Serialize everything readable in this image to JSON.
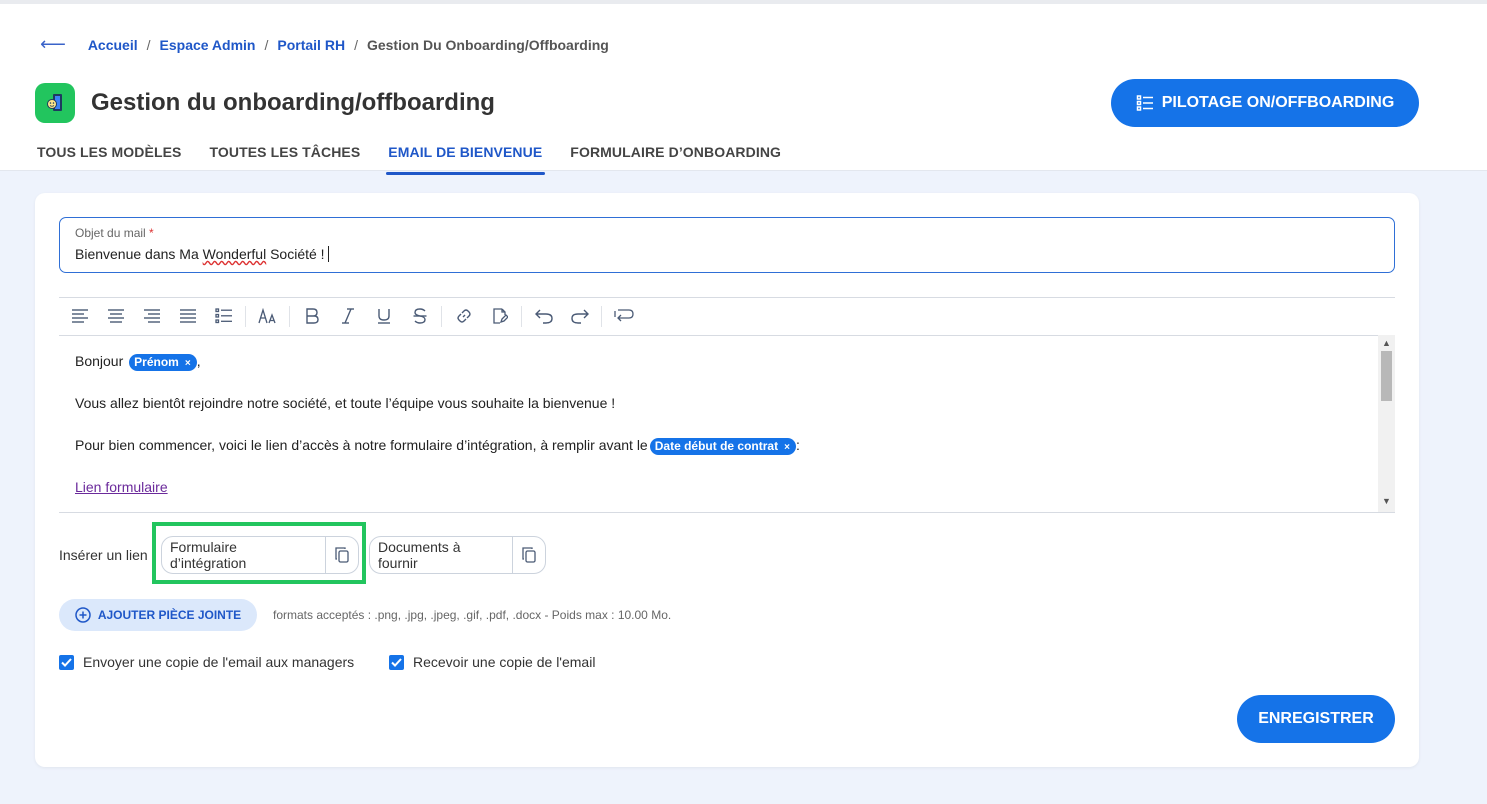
{
  "breadcrumb": {
    "back_icon": "arrow-left-icon",
    "items": [
      "Accueil",
      "Espace Admin",
      "Portail RH"
    ],
    "separator": "/",
    "current": "Gestion Du Onboarding/Offboarding"
  },
  "header": {
    "app_icon": "door-person-icon",
    "title": "Gestion du onboarding/offboarding",
    "pilot_button": "PILOTAGE ON/OFFBOARDING",
    "pilot_icon": "list-icon"
  },
  "tabs": [
    {
      "label": "TOUS LES MODÈLES",
      "active": false
    },
    {
      "label": "TOUTES LES TÂCHES",
      "active": false
    },
    {
      "label": "EMAIL DE BIENVENUE",
      "active": true
    },
    {
      "label": "FORMULAIRE D’ONBOARDING",
      "active": false
    }
  ],
  "subject": {
    "label": "Objet du mail",
    "required_mark": "*",
    "value_before": "Bienvenue dans Ma ",
    "value_misspelled": "Wonderful",
    "value_after": " Société !"
  },
  "toolbar": {
    "icons": [
      "align-left-icon",
      "align-center-icon",
      "align-right-icon",
      "align-justify-icon",
      "list-icon",
      "font-size-icon",
      "bold-icon",
      "italic-icon",
      "underline-icon",
      "strikethrough-icon",
      "link-icon",
      "edit-file-icon",
      "undo-icon",
      "redo-icon",
      "insert-variable-icon"
    ]
  },
  "editor": {
    "line1_text": "Bonjour ",
    "line1_chip": "Prénom",
    "line1_end": ",",
    "line2": "Vous allez bientôt rejoindre notre société, et toute l’équipe vous souhaite la bienvenue !",
    "line3_text": "Pour bien commencer, voici le lien d’accès à notre formulaire d’intégration, à remplir avant le",
    "line3_chip": "Date début de contrat",
    "line3_end": ":",
    "link": "Lien formulaire",
    "chip_remove": "×",
    "scroll_up": "▲",
    "scroll_down": "▼"
  },
  "insert_link": {
    "label": "Insérer un lien",
    "buttons": [
      "Formulaire d’intégration",
      "Documents à fournir"
    ],
    "copy_icon": "copy-icon"
  },
  "attachment": {
    "button": "AJOUTER PIÈCE JOINTE",
    "icon": "plus-circle-icon",
    "formats": "formats acceptés : .png, .jpg, .jpeg, .gif, .pdf, .docx - Poids max : 10.00 Mo."
  },
  "checkboxes": [
    {
      "label": "Envoyer une copie de l'email aux managers",
      "checked": true
    },
    {
      "label": "Recevoir une copie de l'email",
      "checked": true
    }
  ],
  "save_button": "ENREGISTRER",
  "colors": {
    "primary": "#1573e8",
    "link": "#1f57c8",
    "highlight": "#22c55e",
    "background": "#eef3fc"
  }
}
